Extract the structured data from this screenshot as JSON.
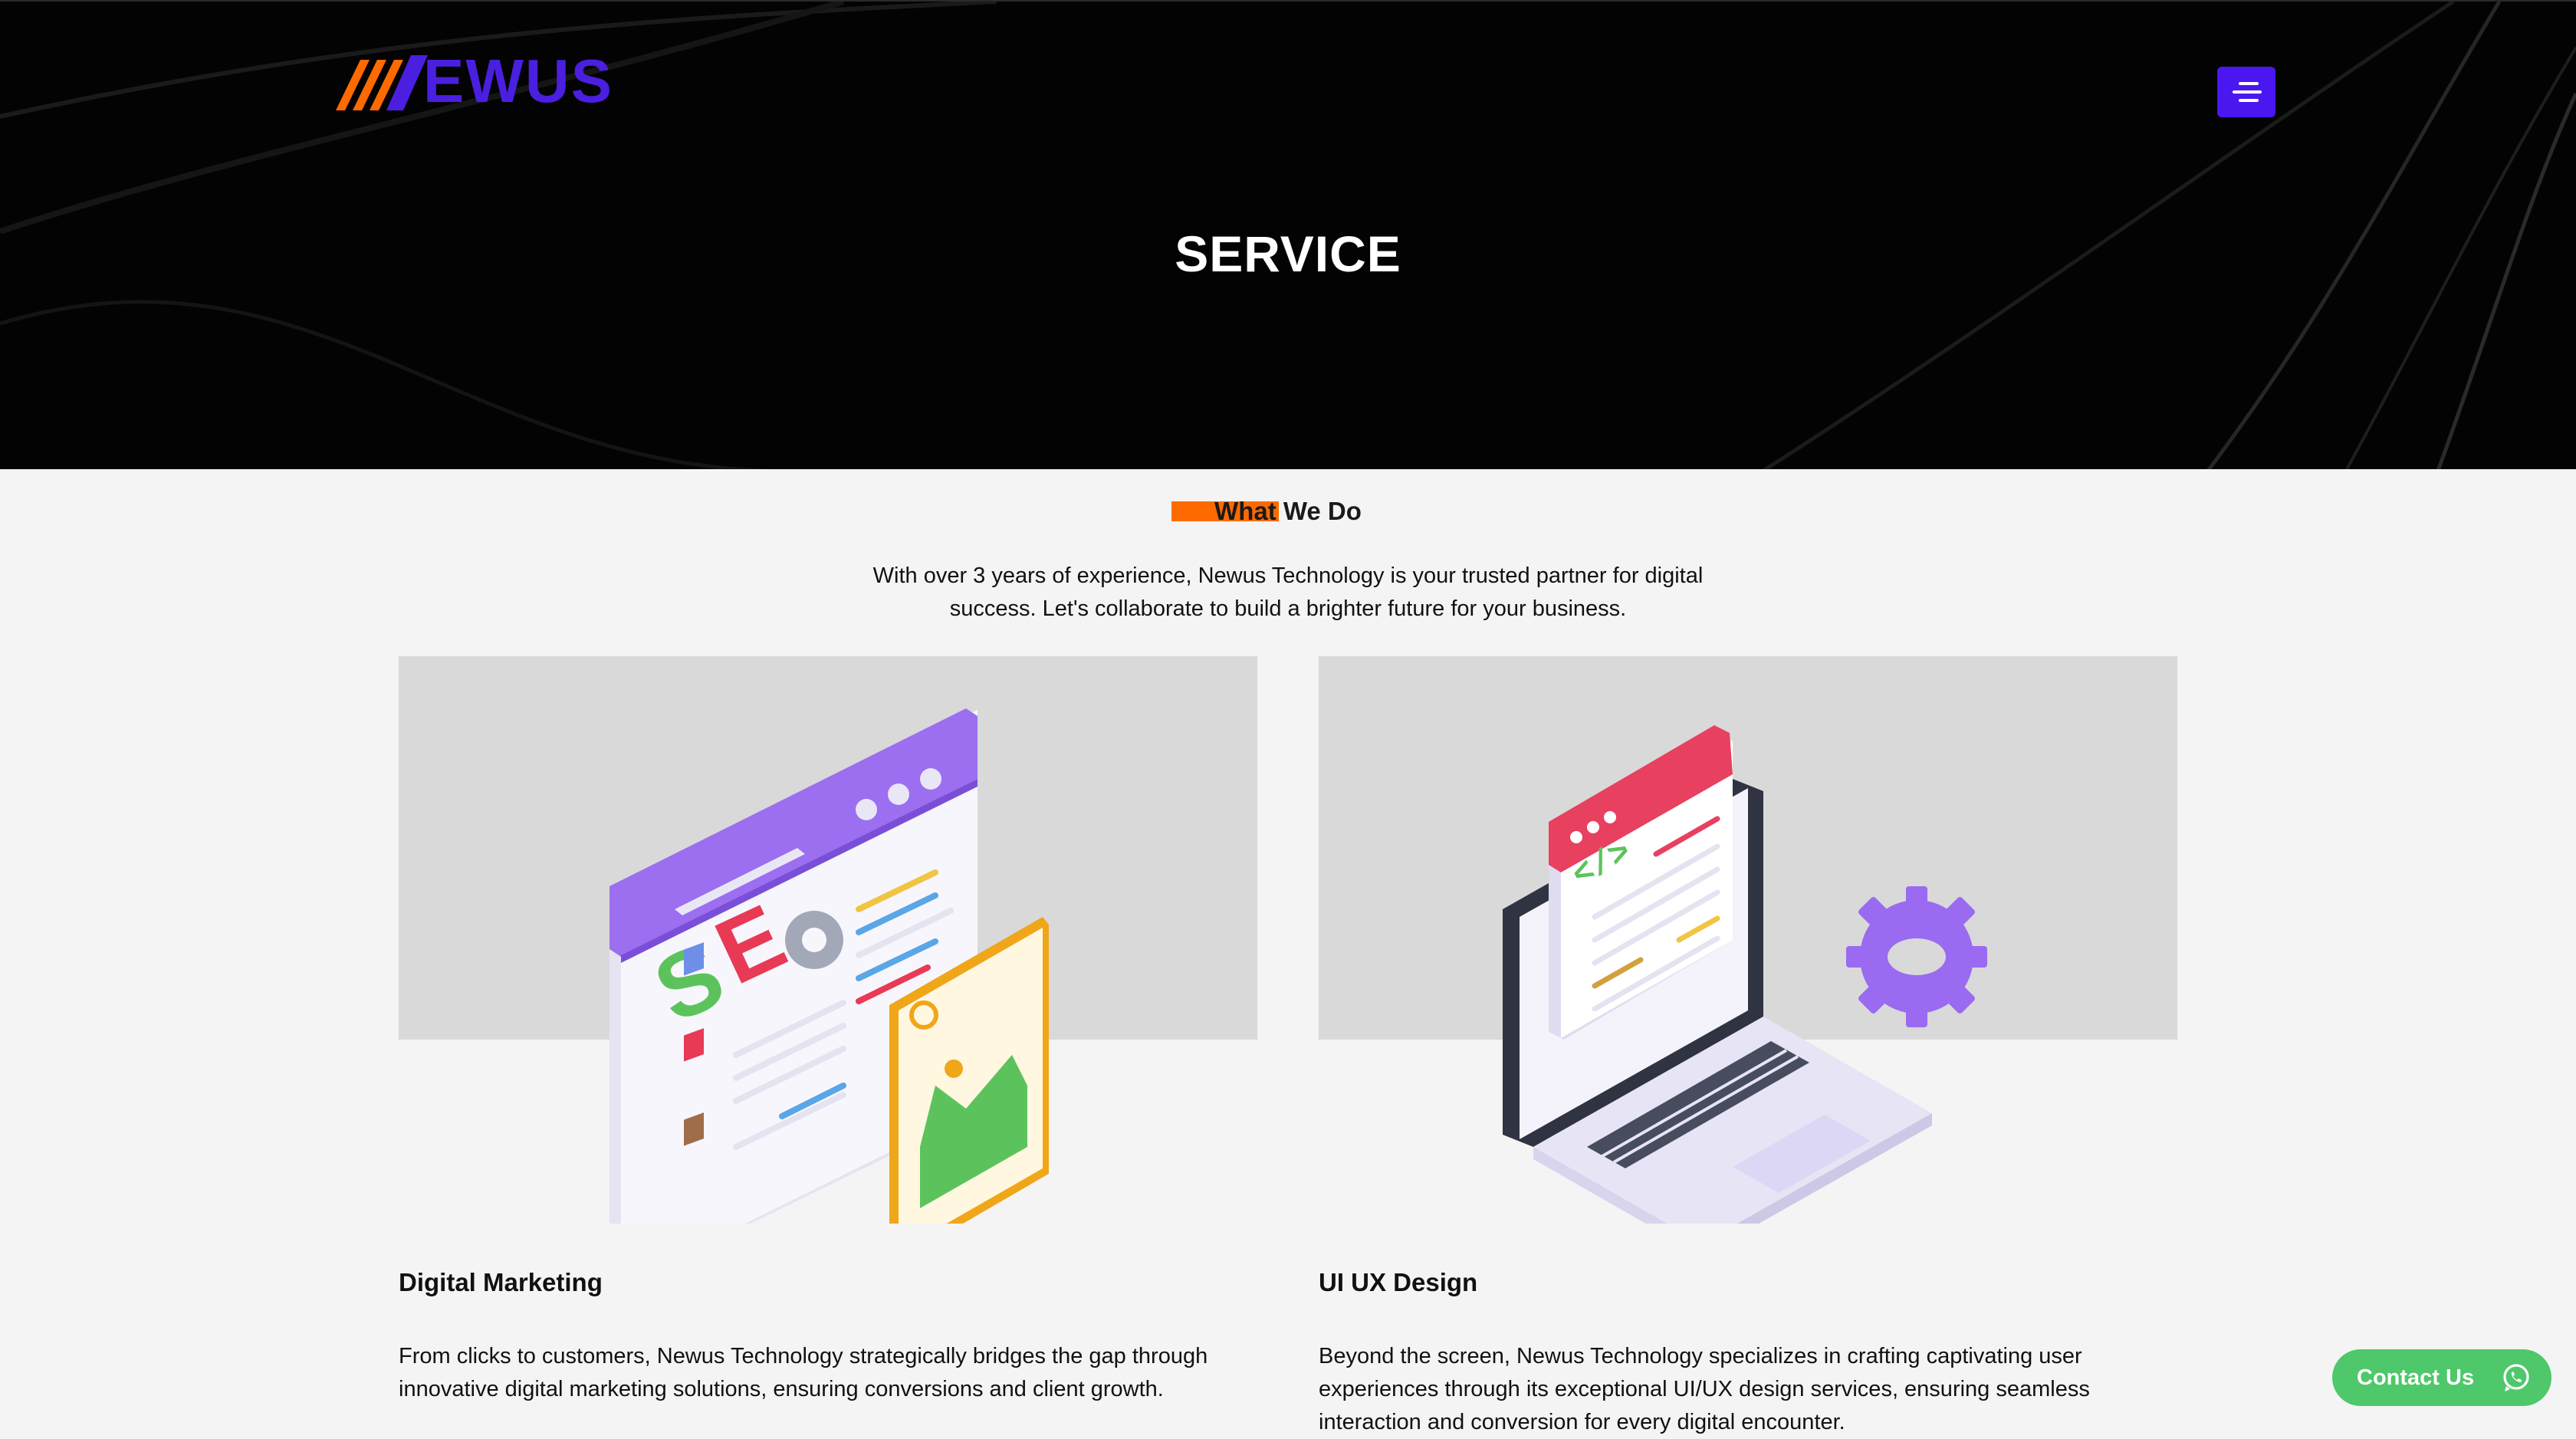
{
  "brand": {
    "logo_text": "EWUS",
    "accent_orange": "#ff6a00",
    "accent_purple": "#4b17f0",
    "logo_icon": "newus-chevron-logo-icon"
  },
  "header": {
    "menu_icon": "hamburger-menu-icon",
    "page_title": "SERVICE"
  },
  "section": {
    "label": "What We Do",
    "intro": "With over 3 years of experience, Newus Technology is your trusted partner for digital success. Let's collaborate to build a brighter future for your business."
  },
  "services": [
    {
      "title": "Digital Marketing",
      "description": "From clicks to customers, Newus Technology strategically bridges the gap through innovative digital marketing solutions, ensuring conversions and client growth.",
      "illustration": "seo-browser-illustration"
    },
    {
      "title": "UI UX Design",
      "description": "Beyond the screen, Newus Technology specializes in crafting captivating user experiences through its exceptional UI/UX design services, ensuring seamless interaction and conversion for every digital encounter.",
      "illustration": "laptop-code-gear-illustration"
    }
  ],
  "contact": {
    "label": "Contact Us",
    "icon": "whatsapp-icon",
    "color": "#4ec86a"
  }
}
